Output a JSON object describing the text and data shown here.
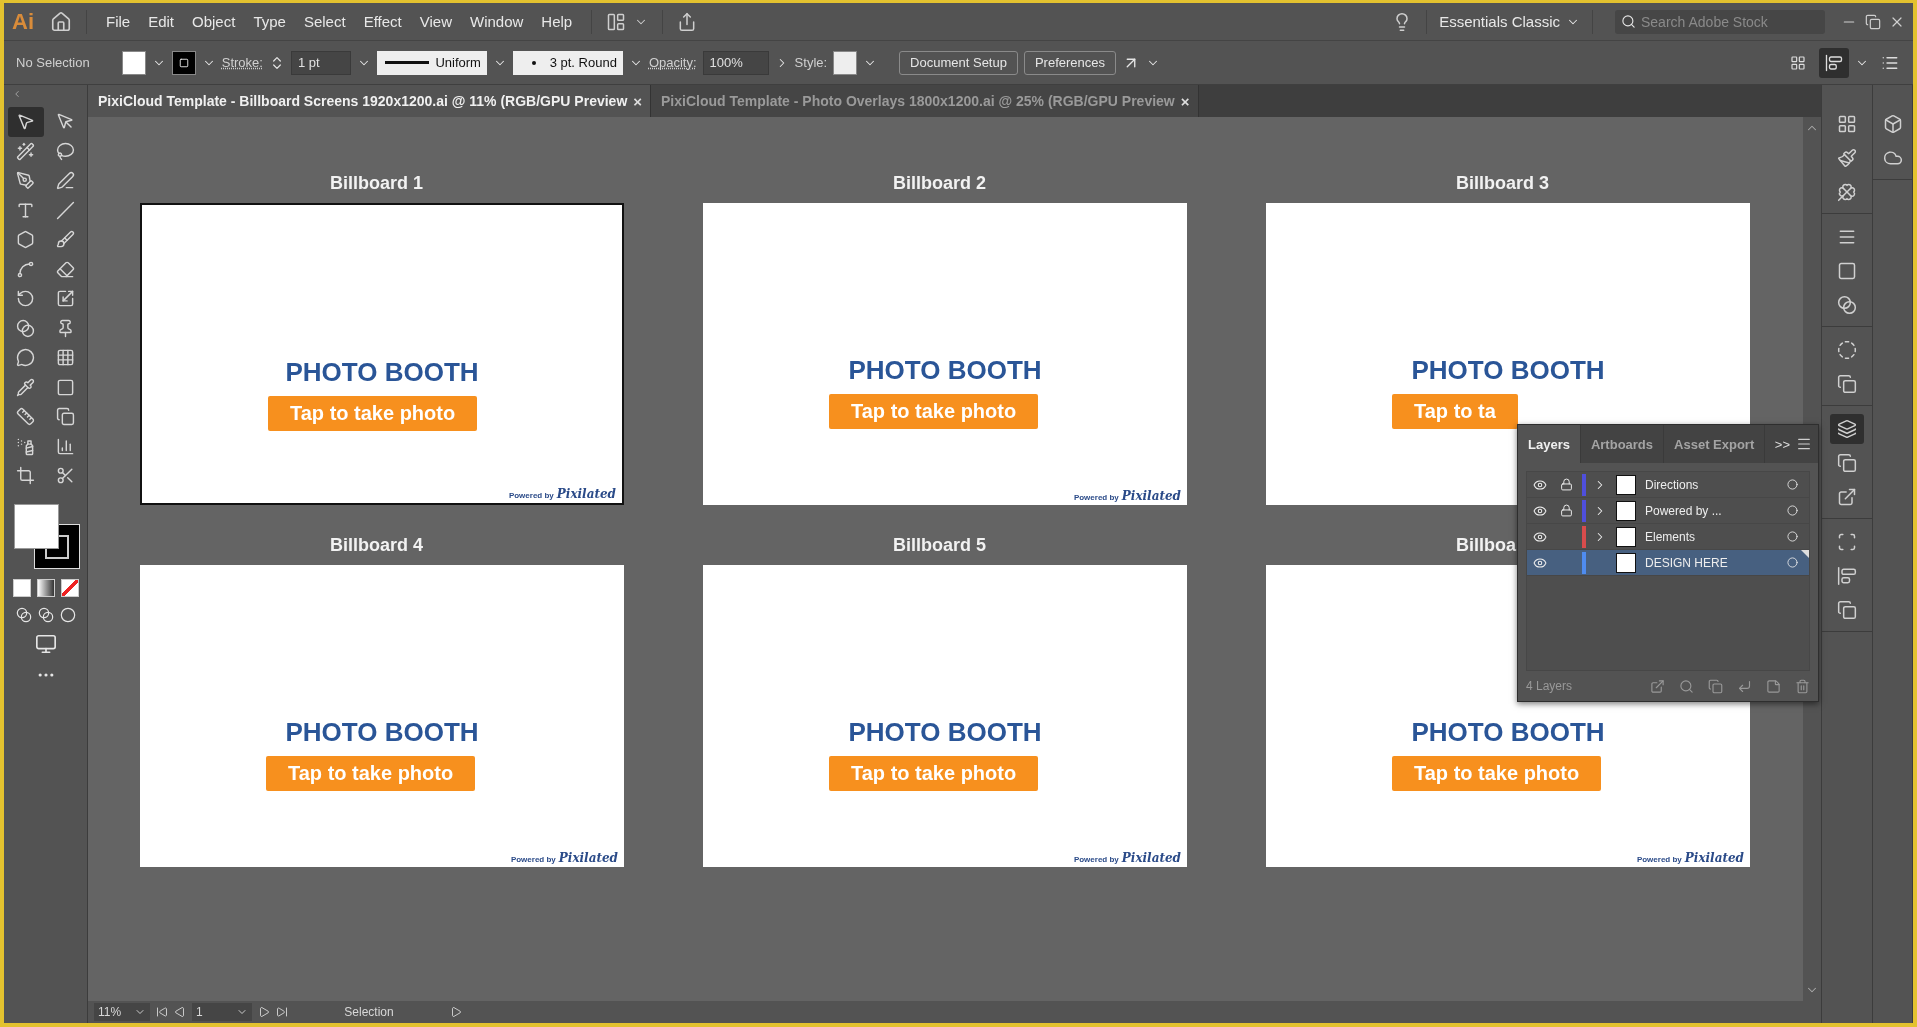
{
  "app": {
    "logo": "Ai",
    "menus": [
      "File",
      "Edit",
      "Object",
      "Type",
      "Select",
      "Effect",
      "View",
      "Window",
      "Help"
    ]
  },
  "workspace": {
    "label": "Essentials Classic"
  },
  "search": {
    "placeholder": "Search Adobe Stock"
  },
  "control_bar": {
    "selection": "No Selection",
    "stroke_label": "Stroke:",
    "stroke_weight": "1 pt",
    "stroke_profile": "Uniform",
    "brush": "3 pt. Round",
    "opacity_label": "Opacity:",
    "opacity": "100%",
    "style_label": "Style:",
    "buttons": [
      "Document Setup",
      "Preferences"
    ]
  },
  "tabs": [
    {
      "label": "PixiCloud Template - Billboard Screens 1920x1200.ai @ 11% (RGB/GPU Preview",
      "close": "×",
      "selected": true
    },
    {
      "label": "PixiCloud Template - Photo Overlays 1800x1200.ai @ 25% (RGB/GPU Preview",
      "close": "×",
      "selected": false
    }
  ],
  "tools": [
    {
      "selected": true
    },
    {
      "selected": false
    },
    {
      "selected": false
    },
    {
      "selected": false
    },
    {
      "selected": false
    },
    {
      "selected": false
    },
    {
      "selected": false
    },
    {
      "selected": false
    },
    {
      "selected": false
    },
    {
      "selected": false
    },
    {
      "selected": false
    },
    {
      "selected": false
    },
    {
      "selected": false
    },
    {
      "selected": false
    },
    {
      "selected": false
    },
    {
      "selected": false
    },
    {
      "selected": false
    },
    {
      "selected": false
    },
    {
      "selected": false
    },
    {
      "selected": false
    },
    {
      "selected": false
    },
    {
      "selected": false
    },
    {
      "selected": false
    },
    {
      "selected": false
    },
    {
      "selected": false
    },
    {
      "selected": false
    }
  ],
  "artboards": [
    {
      "title": "Billboard 1",
      "heading": "PHOTO BOOTH",
      "button": "Tap to take photo",
      "credit": "Powered by",
      "logo": "Pixilated",
      "selected": true
    },
    {
      "title": "Billboard 2",
      "heading": "PHOTO BOOTH",
      "button": "Tap to take photo",
      "credit": "Powered by",
      "logo": "Pixilated",
      "selected": false
    },
    {
      "title": "Billboard 3",
      "heading": "PHOTO BOOTH",
      "button": "Tap to ta",
      "selected": false
    },
    {
      "title": "Billboard 4",
      "heading": "PHOTO BOOTH",
      "button": "Tap to take photo",
      "credit": "Powered by",
      "logo": "Pixilated",
      "selected": false
    },
    {
      "title": "Billboard 5",
      "heading": "PHOTO BOOTH",
      "button": "Tap to take photo",
      "credit": "Powered by",
      "logo": "Pixilated",
      "selected": false
    },
    {
      "title": "Billboa",
      "heading": "PHOTO BOOTH",
      "button": "Tap to take photo",
      "credit": "Powered by",
      "logo": "Pixilated",
      "selected": false
    }
  ],
  "layers_panel": {
    "tabs": [
      {
        "label": "Layers",
        "selected": true
      },
      {
        "label": "Artboards",
        "selected": false
      },
      {
        "label": "Asset Export",
        "selected": false
      }
    ],
    "overflow": ">>",
    "rows": [
      {
        "name": "Directions",
        "visible": true,
        "locked": true,
        "expandable": true,
        "color": "#4f4fdc",
        "selected": false
      },
      {
        "name": "Powered by ...",
        "visible": true,
        "locked": true,
        "expandable": true,
        "color": "#4f4fdc",
        "selected": false
      },
      {
        "name": "Elements",
        "visible": true,
        "locked": false,
        "expandable": true,
        "color": "#d84c4c",
        "selected": false
      },
      {
        "name": "DESIGN HERE",
        "visible": true,
        "locked": false,
        "expandable": false,
        "color": "#4f8cf0",
        "selected": true
      }
    ],
    "count": "4 Layers"
  },
  "dock_icons": [
    {
      "selected": false
    },
    {
      "selected": false
    },
    {
      "selected": false
    },
    {
      "selected": false
    },
    {
      "selected": false
    },
    {
      "selected": false
    },
    {
      "selected": false
    },
    {
      "selected": false
    },
    {
      "selected": true
    },
    {
      "selected": false
    },
    {
      "selected": false
    },
    {
      "selected": false
    },
    {
      "selected": false
    },
    {
      "selected": false
    }
  ],
  "status_bar": {
    "zoom": "11%",
    "artboard": "1",
    "tool": "Selection"
  }
}
